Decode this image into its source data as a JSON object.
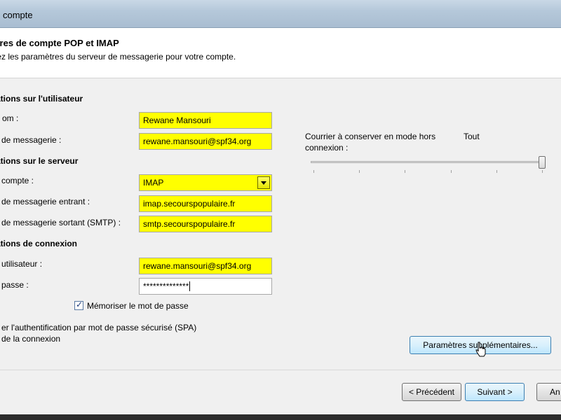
{
  "window": {
    "title": "compte"
  },
  "header": {
    "title": "ètres de compte POP et IMAP",
    "subtitle": "trez les paramètres du serveur de messagerie pour votre compte."
  },
  "user_info": {
    "section_title": "ations sur l'utilisateur",
    "name_label": "om :",
    "name_value": "Rewane Mansouri",
    "email_label": "de messagerie :",
    "email_value": "rewane.mansouri@spf34.org"
  },
  "server_info": {
    "section_title": "ations sur le serveur",
    "account_type_label": "compte :",
    "account_type_value": "IMAP",
    "incoming_label": "de messagerie entrant :",
    "incoming_value": "imap.secourspopulaire.fr",
    "outgoing_label": "de messagerie sortant (SMTP) :",
    "outgoing_value": "smtp.secourspopulaire.fr"
  },
  "login_info": {
    "section_title": "ations de connexion",
    "username_label": "utilisateur :",
    "username_value": "rewane.mansouri@spf34.org",
    "password_label": "passe :",
    "password_value": "**************",
    "remember_label": "Mémoriser le mot de passe",
    "remember_checked": true,
    "spa_label_line1": "er l'authentification par mot de passe sécurisé (SPA)",
    "spa_label_line2": "de la connexion"
  },
  "offline": {
    "label_line1": "Courrier à conserver en mode hors",
    "label_line2": "connexion :",
    "value": "Tout",
    "slider_position_fraction": 1.0
  },
  "buttons": {
    "more_settings": "Paramètres supplémentaires...",
    "previous": "< Précédent",
    "next": "Suivant >",
    "cancel": "An"
  },
  "colors": {
    "highlight": "#ffff00",
    "dialog_bg": "#f0f0f0",
    "focus_border": "#3c7fb1"
  },
  "icons": {
    "dropdown": "chevron-down-icon",
    "check": "checkmark-icon",
    "cursor": "hand-pointer-icon"
  }
}
